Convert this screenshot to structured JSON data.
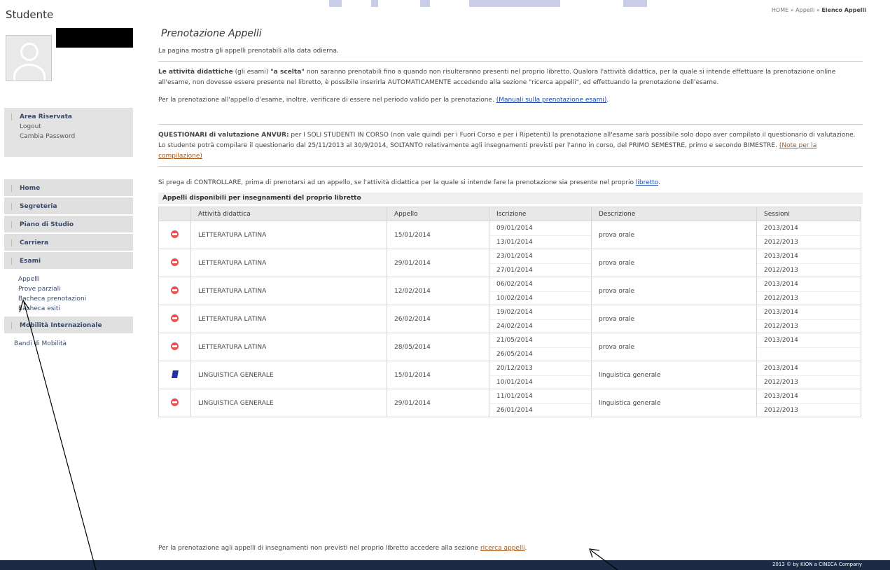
{
  "breadcrumb": {
    "home": "HOME",
    "sep1": " » ",
    "appelli": "Appelli",
    "sep2": " » ",
    "current": "Elenco Appelli"
  },
  "sidebar": {
    "title": "Studente",
    "area": {
      "title": "Area Riservata",
      "links": [
        "Logout",
        "Cambia Password"
      ]
    },
    "menu": {
      "home": "Home",
      "segreteria": "Segreteria",
      "piano": "Piano di Studio",
      "carriera": "Carriera",
      "esami": "Esami",
      "esami_sub": [
        "Appelli",
        "Prove parziali",
        "Bacheca prenotazioni",
        "Bacheca esiti"
      ],
      "mobilita": "Mobilità Internazionale",
      "mobilita_sub": [
        "Bandi di Mobilità"
      ]
    }
  },
  "main": {
    "title": "Prenotazione Appelli",
    "intro": "La pagina mostra gli appelli prenotabili alla data odierna.",
    "par1_bold": "Le attività didattiche",
    "par1_a": " (gli esami) ",
    "par1_bold2": "\"a scelta\"",
    "par1_b": " non saranno prenotabili fino a quando non risulteranno presenti nel proprio libretto. Qualora l'attività didattica, per la quale si intende effettuare la prenotazione online all'esame, non dovesse essere presente nel libretto, è possibile inserirla AUTOMATICAMENTE accedendo alla sezione \"ricerca appelli\", ed effettuando la prenotazione dell'esame.",
    "par2": "Per la prenotazione all'appello d'esame, inoltre, verificare di essere nel periodo valido per la prenotazione. ",
    "par2_link": "(Manuali sulla prenotazione esami)",
    "par2_end": ".",
    "par3_bold": "QUESTIONARI di valutazione ANVUR:",
    "par3": " per I SOLI STUDENTI IN CORSO (non vale quindi per i Fuori Corso e per i Ripetenti) la prenotazione all'esame sarà possibile solo dopo aver compilato il questionario di valutazione. Lo studente potrà compilare il questionario dal 25/11/2013 al 30/9/2014, SOLTANTO relativamente agli insegnamenti previsti per l'anno in corso, del PRIMO SEMESTRE, primo e secondo BIMESTRE. ",
    "par3_link": "(Note per la compilazione)",
    "par4": "Si prega di CONTROLLARE, prima di prenotarsi ad un appello, se l'attività didattica per la quale si intende fare la prenotazione sia presente nel proprio ",
    "par4_link": "libretto",
    "par4_end": ".",
    "table_caption": "Appelli disponibili per insegnamenti del proprio libretto",
    "headers": [
      "Attività didattica",
      "Appello",
      "Iscrizione",
      "Descrizione",
      "Sessioni"
    ],
    "rows": [
      {
        "status": "not-allowed",
        "attivita": "LETTERATURA LATINA",
        "appello": "15/01/2014",
        "iscr_da": "09/01/2014",
        "iscr_a": "13/01/2014",
        "descr": "prova orale",
        "sess1": "2013/2014",
        "sess2": "2012/2013"
      },
      {
        "status": "not-allowed",
        "attivita": "LETTERATURA LATINA",
        "appello": "29/01/2014",
        "iscr_da": "23/01/2014",
        "iscr_a": "27/01/2014",
        "descr": "prova orale",
        "sess1": "2013/2014",
        "sess2": "2012/2013"
      },
      {
        "status": "not-allowed",
        "attivita": "LETTERATURA LATINA",
        "appello": "12/02/2014",
        "iscr_da": "06/02/2014",
        "iscr_a": "10/02/2014",
        "descr": "prova orale",
        "sess1": "2013/2014",
        "sess2": "2012/2013"
      },
      {
        "status": "not-allowed",
        "attivita": "LETTERATURA LATINA",
        "appello": "26/02/2014",
        "iscr_da": "19/02/2014",
        "iscr_a": "24/02/2014",
        "descr": "prova orale",
        "sess1": "2013/2014",
        "sess2": "2012/2013"
      },
      {
        "status": "not-allowed",
        "attivita": "LETTERATURA LATINA",
        "appello": "28/05/2014",
        "iscr_da": "21/05/2014",
        "iscr_a": "26/05/2014",
        "descr": "prova orale",
        "sess1": "2013/2014",
        "sess2": ""
      },
      {
        "status": "book",
        "attivita": "LINGUISTICA GENERALE",
        "appello": "15/01/2014",
        "iscr_da": "20/12/2013",
        "iscr_a": "10/01/2014",
        "descr": "linguistica generale",
        "sess1": "2013/2014",
        "sess2": "2012/2013"
      },
      {
        "status": "not-allowed",
        "attivita": "LINGUISTICA GENERALE",
        "appello": "29/01/2014",
        "iscr_da": "11/01/2014",
        "iscr_a": "26/01/2014",
        "descr": "linguistica generale",
        "sess1": "2013/2014",
        "sess2": "2012/2013"
      }
    ],
    "bottom_note": "Per la prenotazione agli appelli di insegnamenti non previsti nel proprio libretto accedere alla sezione ",
    "bottom_link": "ricerca appelli",
    "bottom_end": "."
  },
  "footer": {
    "text": "2013 © by KION a CINECA Company"
  },
  "colors": {
    "footer": "#1c2a45",
    "menu": "#e0e0e0",
    "link": "#1a4aa8",
    "status_no": "#e55050"
  }
}
